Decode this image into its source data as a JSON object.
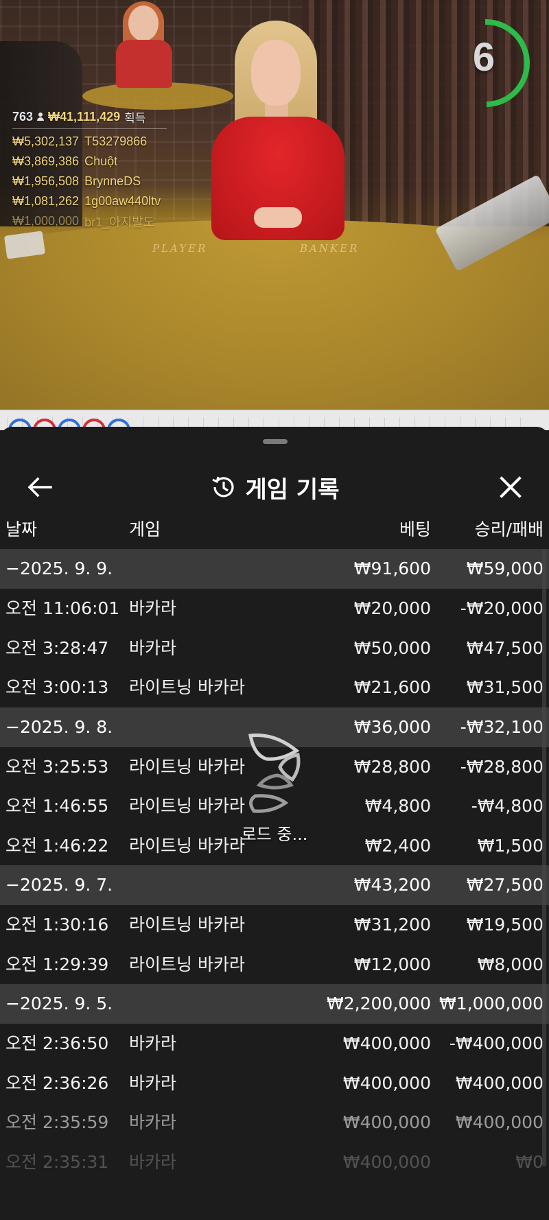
{
  "live": {
    "timer": "6",
    "table_labels": {
      "player": "PLAYER",
      "banker": "BANKER"
    },
    "winners": {
      "count": "763",
      "total": "₩41,111,429",
      "total_label": "획득",
      "list": [
        {
          "amount": "₩5,302,137",
          "name": "T53279866"
        },
        {
          "amount": "₩3,869,386",
          "name": "Chuột"
        },
        {
          "amount": "₩1,956,508",
          "name": "BrynneDS"
        },
        {
          "amount": "₩1,081,262",
          "name": "1g00aw440ltv"
        },
        {
          "amount": "₩1,000,000",
          "name": "br1_아지발도"
        }
      ]
    }
  },
  "history": {
    "title": "게임 기록",
    "columns": {
      "date": "날짜",
      "game": "게임",
      "bet": "베팅",
      "result": "승리/패배"
    },
    "groups": [
      {
        "date": "−2025. 9. 9.",
        "bet": "₩91,600",
        "result": "₩59,000",
        "rows": [
          {
            "time": "오전 11:06:01",
            "game": "바카라",
            "bet": "₩20,000",
            "result": "-₩20,000"
          },
          {
            "time": "오전 3:28:47",
            "game": "바카라",
            "bet": "₩50,000",
            "result": "₩47,500"
          },
          {
            "time": "오전 3:00:13",
            "game": "라이트닝 바카라",
            "bet": "₩21,600",
            "result": "₩31,500"
          }
        ]
      },
      {
        "date": "−2025. 9. 8.",
        "bet": "₩36,000",
        "result": "-₩32,100",
        "rows": [
          {
            "time": "오전 3:25:53",
            "game": "라이트닝 바카라",
            "bet": "₩28,800",
            "result": "-₩28,800"
          },
          {
            "time": "오전 1:46:55",
            "game": "라이트닝 바카라",
            "bet": "₩4,800",
            "result": "-₩4,800"
          },
          {
            "time": "오전 1:46:22",
            "game": "라이트닝 바카라",
            "bet": "₩2,400",
            "result": "₩1,500"
          }
        ]
      },
      {
        "date": "−2025. 9. 7.",
        "bet": "₩43,200",
        "result": "₩27,500",
        "rows": [
          {
            "time": "오전 1:30:16",
            "game": "라이트닝 바카라",
            "bet": "₩31,200",
            "result": "₩19,500"
          },
          {
            "time": "오전 1:29:39",
            "game": "라이트닝 바카라",
            "bet": "₩12,000",
            "result": "₩8,000"
          }
        ]
      },
      {
        "date": "−2025. 9. 5.",
        "bet": "₩2,200,000",
        "result": "₩1,000,000",
        "rows": [
          {
            "time": "오전 2:36:50",
            "game": "바카라",
            "bet": "₩400,000",
            "result": "-₩400,000"
          },
          {
            "time": "오전 2:36:26",
            "game": "바카라",
            "bet": "₩400,000",
            "result": "₩400,000"
          },
          {
            "time": "오전 2:35:59",
            "game": "바카라",
            "bet": "₩400,000",
            "result": "₩400,000"
          },
          {
            "time": "오전 2:35:31",
            "game": "바카라",
            "bet": "₩400,000",
            "result": "₩0"
          }
        ]
      }
    ],
    "loading_label": "로드 중..."
  },
  "colors": {
    "sheet_bg": "#1c1c1c",
    "group_bg": "#3b3b3b",
    "timer_ring": "#2dbb4a",
    "winner_gold": "#f0d47a",
    "bead_blue": "#2f6fd6",
    "bead_red": "#d0303a"
  },
  "icons": {
    "back": "arrow-left-icon",
    "history": "history-clock-icon",
    "close": "close-icon",
    "loading": "spinner-icon"
  }
}
